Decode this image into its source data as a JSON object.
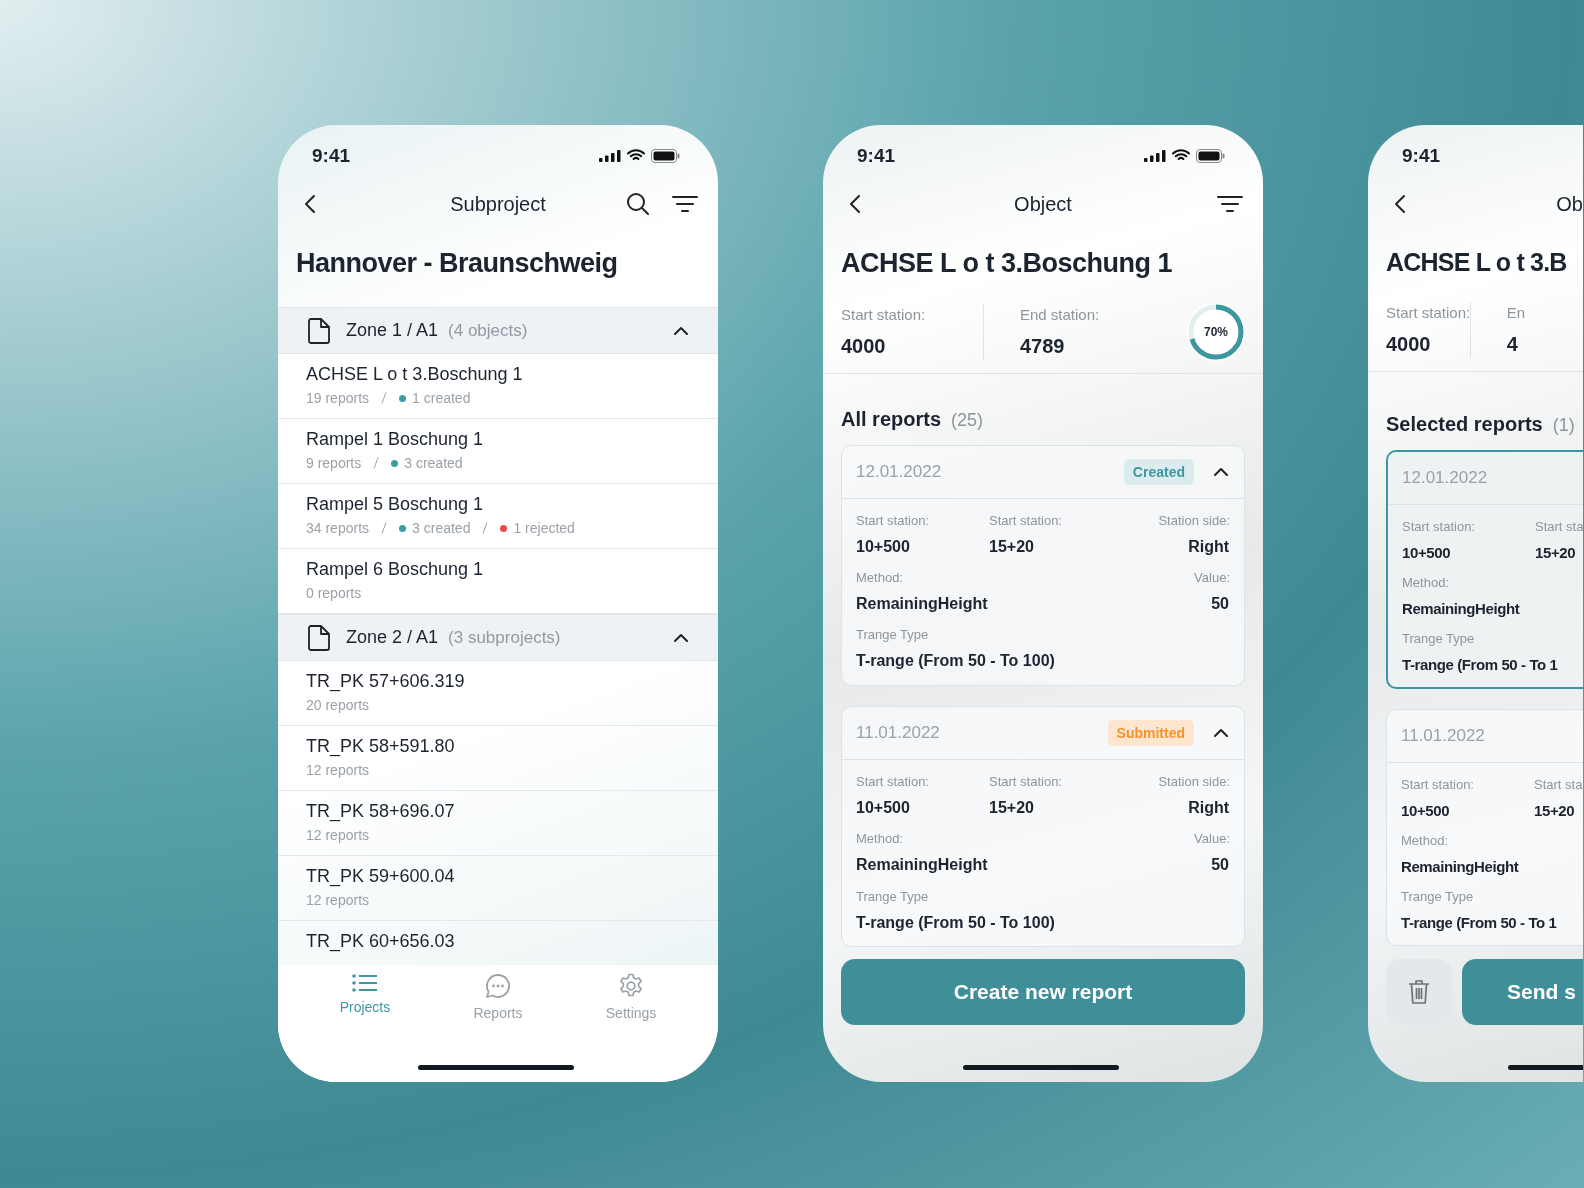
{
  "phones": [
    {
      "kind": "list",
      "time": "9:41",
      "nav": {
        "title": "Subproject",
        "actions": [
          {
            "kind": "search"
          },
          {
            "kind": "filter"
          }
        ]
      },
      "heading": "Hannover - Braunschweig",
      "groups": [
        {
          "title": "Zone 1 / A1",
          "count": "(4 objects)",
          "expanded": true,
          "items": [
            {
              "title": "ACHSE L o t 3.Boschung 1",
              "meta": [
                {
                  "text": "19 reports"
                },
                {
                  "text": "1 created",
                  "color": "#3b9ea6"
                }
              ]
            },
            {
              "title": "Rampel 1 Boschung 1",
              "meta": [
                {
                  "text": "9 reports"
                },
                {
                  "text": "3 created",
                  "color": "#3b9ea6"
                }
              ]
            },
            {
              "title": "Rampel 5 Boschung 1",
              "meta": [
                {
                  "text": "34 reports"
                },
                {
                  "text": "3 created",
                  "color": "#3b9ea6"
                },
                {
                  "text": "1 rejected",
                  "color": "#f04848"
                }
              ]
            },
            {
              "title": "Rampel 6 Boschung 1",
              "meta": [
                {
                  "text": "0 reports"
                }
              ]
            }
          ]
        },
        {
          "title": "Zone 2 / A1",
          "count": "(3 subprojects)",
          "expanded": true,
          "items": [
            {
              "title": "TR_PK 57+606.319",
              "meta": [
                {
                  "text": "20 reports"
                }
              ]
            },
            {
              "title": "TR_PK 58+591.80",
              "meta": [
                {
                  "text": "12 reports"
                }
              ]
            },
            {
              "title": "TR_PK 58+696.07",
              "meta": [
                {
                  "text": "12 reports"
                }
              ]
            },
            {
              "title": "TR_PK 59+600.04",
              "meta": [
                {
                  "text": "12 reports"
                }
              ]
            },
            {
              "title": "TR_PK 60+656.03"
            }
          ]
        }
      ],
      "tab_bar": [
        {
          "label": "Projects",
          "selected": true
        },
        {
          "label": "Reports",
          "selected": false
        },
        {
          "label": "Settings",
          "selected": false
        }
      ]
    },
    {
      "kind": "object",
      "time": "9:41",
      "nav": {
        "title": "Object",
        "actions": [
          {
            "kind": "filter"
          }
        ]
      },
      "heading": "ACHSE L o t 3.Boschung 1",
      "stations": [
        {
          "label": "Start station:",
          "value": "4000"
        },
        {
          "label": "End station:",
          "value": "4789"
        }
      ],
      "progress": {
        "level": 0.7,
        "label": "70%"
      },
      "reports_title": "All reports",
      "reports_count": "(25)",
      "reports": [
        {
          "date": "12.01.2022",
          "status": {
            "label": "Created",
            "kind": "created"
          },
          "expanded": true,
          "selected": false,
          "rows": [
            [
              {
                "label": "Start station:",
                "value": "10+500"
              },
              {
                "label": "Start station:",
                "value": "15+20"
              },
              {
                "label": "Station side:",
                "value": "Right"
              }
            ],
            [
              {
                "label": "Method:",
                "value": "RemainingHeight"
              },
              "",
              {
                "label": "Value:",
                "value": "50"
              }
            ],
            [
              {
                "label": "Trange Type",
                "value": "T-range (From 50 - To 100)"
              }
            ]
          ]
        },
        {
          "date": "11.01.2022",
          "status": {
            "label": "Submitted",
            "kind": "submitted"
          },
          "expanded": true,
          "selected": false,
          "rows": [
            [
              {
                "label": "Start station:",
                "value": "10+500"
              },
              {
                "label": "Start station:",
                "value": "15+20"
              },
              {
                "label": "Station side:",
                "value": "Right"
              }
            ],
            [
              {
                "label": "Method:",
                "value": "RemainingHeight"
              },
              "",
              {
                "label": "Value:",
                "value": "50"
              }
            ],
            [
              {
                "label": "Trange Type",
                "value": "T-range (From 50 - To 100)"
              }
            ]
          ]
        }
      ],
      "actions": [
        {
          "kind": "primary",
          "label": "Create new report"
        }
      ]
    },
    {
      "kind": "object",
      "time": "9:41",
      "nav": {
        "title": "Ob"
      },
      "heading": "ACHSE L o t 3.B",
      "stations": [
        {
          "label": "Start station:",
          "value": "4000"
        },
        {
          "label": "En",
          "value": "4"
        }
      ],
      "reports_title": "Selected reports",
      "reports_count": "(1)",
      "reports": [
        {
          "date": "12.01.2022",
          "selected": true,
          "rows": [
            [
              {
                "label": "Start station:",
                "value": "10+500"
              },
              {
                "label": "Start sta",
                "value": "15+20"
              }
            ],
            [
              {
                "label": "Method:",
                "value": "RemainingHeight"
              }
            ],
            [
              {
                "label": "Trange Type",
                "value": "T-range (From 50 - To 1"
              }
            ]
          ]
        },
        {
          "date": "11.01.2022",
          "selected": false,
          "rows": [
            [
              {
                "label": "Start station:",
                "value": "10+500"
              },
              {
                "label": "Start sta",
                "value": "15+20"
              }
            ],
            [
              {
                "label": "Method:",
                "value": "RemainingHeight"
              }
            ],
            [
              {
                "label": "Trange Type",
                "value": "T-range (From 50 - To 1"
              }
            ]
          ]
        }
      ],
      "actions": [
        {
          "kind": "trash"
        },
        {
          "kind": "primary",
          "label": "Send s"
        }
      ]
    }
  ]
}
